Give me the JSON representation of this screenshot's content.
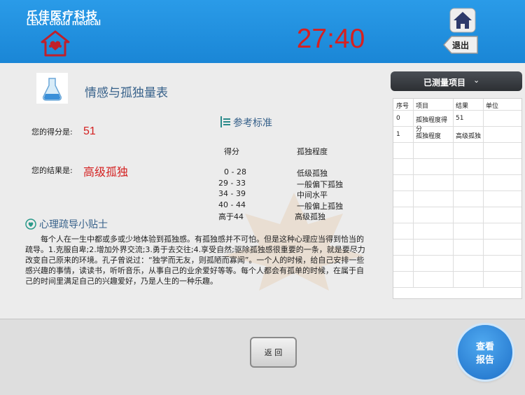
{
  "header": {
    "brand_cn": "乐佳医疗科技",
    "brand_en": "LEKA cloud medical",
    "timer": "27:40",
    "exit_label": "退出",
    "bg_color": "#1a86d6",
    "timer_color": "#d62020"
  },
  "scale": {
    "title": "情感与孤独量表",
    "score_label": "您的得分是:",
    "score_value": "51",
    "result_label": "您的结果是:",
    "result_value": "高级孤独"
  },
  "reference": {
    "title": "参考标准",
    "col_score": "得分",
    "col_level": "孤独程度",
    "rows": [
      {
        "range": "0 - 28",
        "level": "低级孤独"
      },
      {
        "range": "29 - 33",
        "level": "一般偏下孤独"
      },
      {
        "range": "34 - 39",
        "level": "中间水平"
      },
      {
        "range": "40 - 44",
        "level": "一般偏上孤独"
      },
      {
        "range": "高于44",
        "level": "高级孤独"
      }
    ]
  },
  "tips": {
    "title": "心理疏导小贴士",
    "text": "每个人在一生中都或多或少地体验到孤独感。有孤独感并不可怕。但是这种心理应当得到恰当的疏导。1.克服自卑;2.增加外界交流;3.勇于去交往;4.享受自然;驱除孤独感很重要的一条，就是要尽力改变自己原来的环境。孔子曾说过：“独学而无友，则孤陋而寡闻”。一个人的时候，给自己安排一些感兴趣的事情，读读书，听听音乐，从事自己的业余爱好等等。每个人都会有孤单的时候，在属于自己的时间里满足自己的兴趣爱好，乃是人生的一种乐趣。"
  },
  "panel": {
    "dropdown_label": "已测量项目",
    "dropdown_icon": "chevron-down-icon",
    "columns": [
      "序号",
      "项目",
      "结果",
      "单位"
    ],
    "rows": [
      [
        "0",
        "孤独程度得分",
        "51",
        ""
      ],
      [
        "1",
        "孤独程度",
        "高级孤独",
        ""
      ]
    ]
  },
  "footer": {
    "back_label": "返  回",
    "report_line1": "查看",
    "report_line2": "报告",
    "report_color": "#1d6fc8"
  }
}
